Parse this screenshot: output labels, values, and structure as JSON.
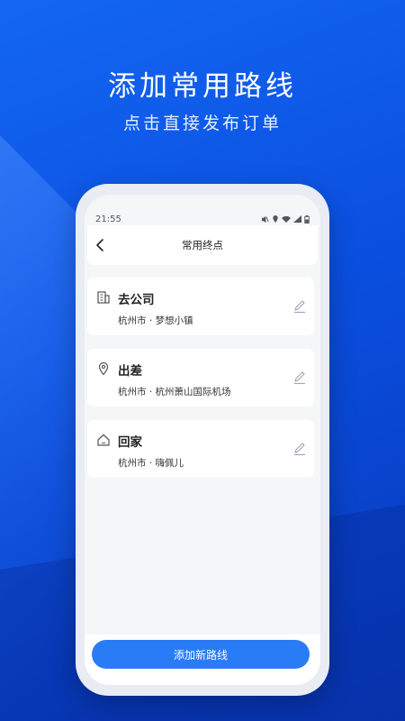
{
  "hero": {
    "title": "添加常用路线",
    "subtitle": "点击直接发布订单"
  },
  "status_bar": {
    "time": "21:55"
  },
  "navbar": {
    "title": "常用终点",
    "back_icon": "chevron-left-icon"
  },
  "routes": [
    {
      "name": "去公司",
      "address": "杭州市 · 梦想小镇",
      "icon": "building-icon"
    },
    {
      "name": "出差",
      "address": "杭州市 · 杭州萧山国际机场",
      "icon": "location-pin-icon"
    },
    {
      "name": "回家",
      "address": "杭州市 · 嗨佩儿",
      "icon": "home-icon"
    }
  ],
  "add_button": {
    "label": "添加新路线"
  },
  "colors": {
    "brand": "#1466f3",
    "button": "#2a7cf6"
  }
}
